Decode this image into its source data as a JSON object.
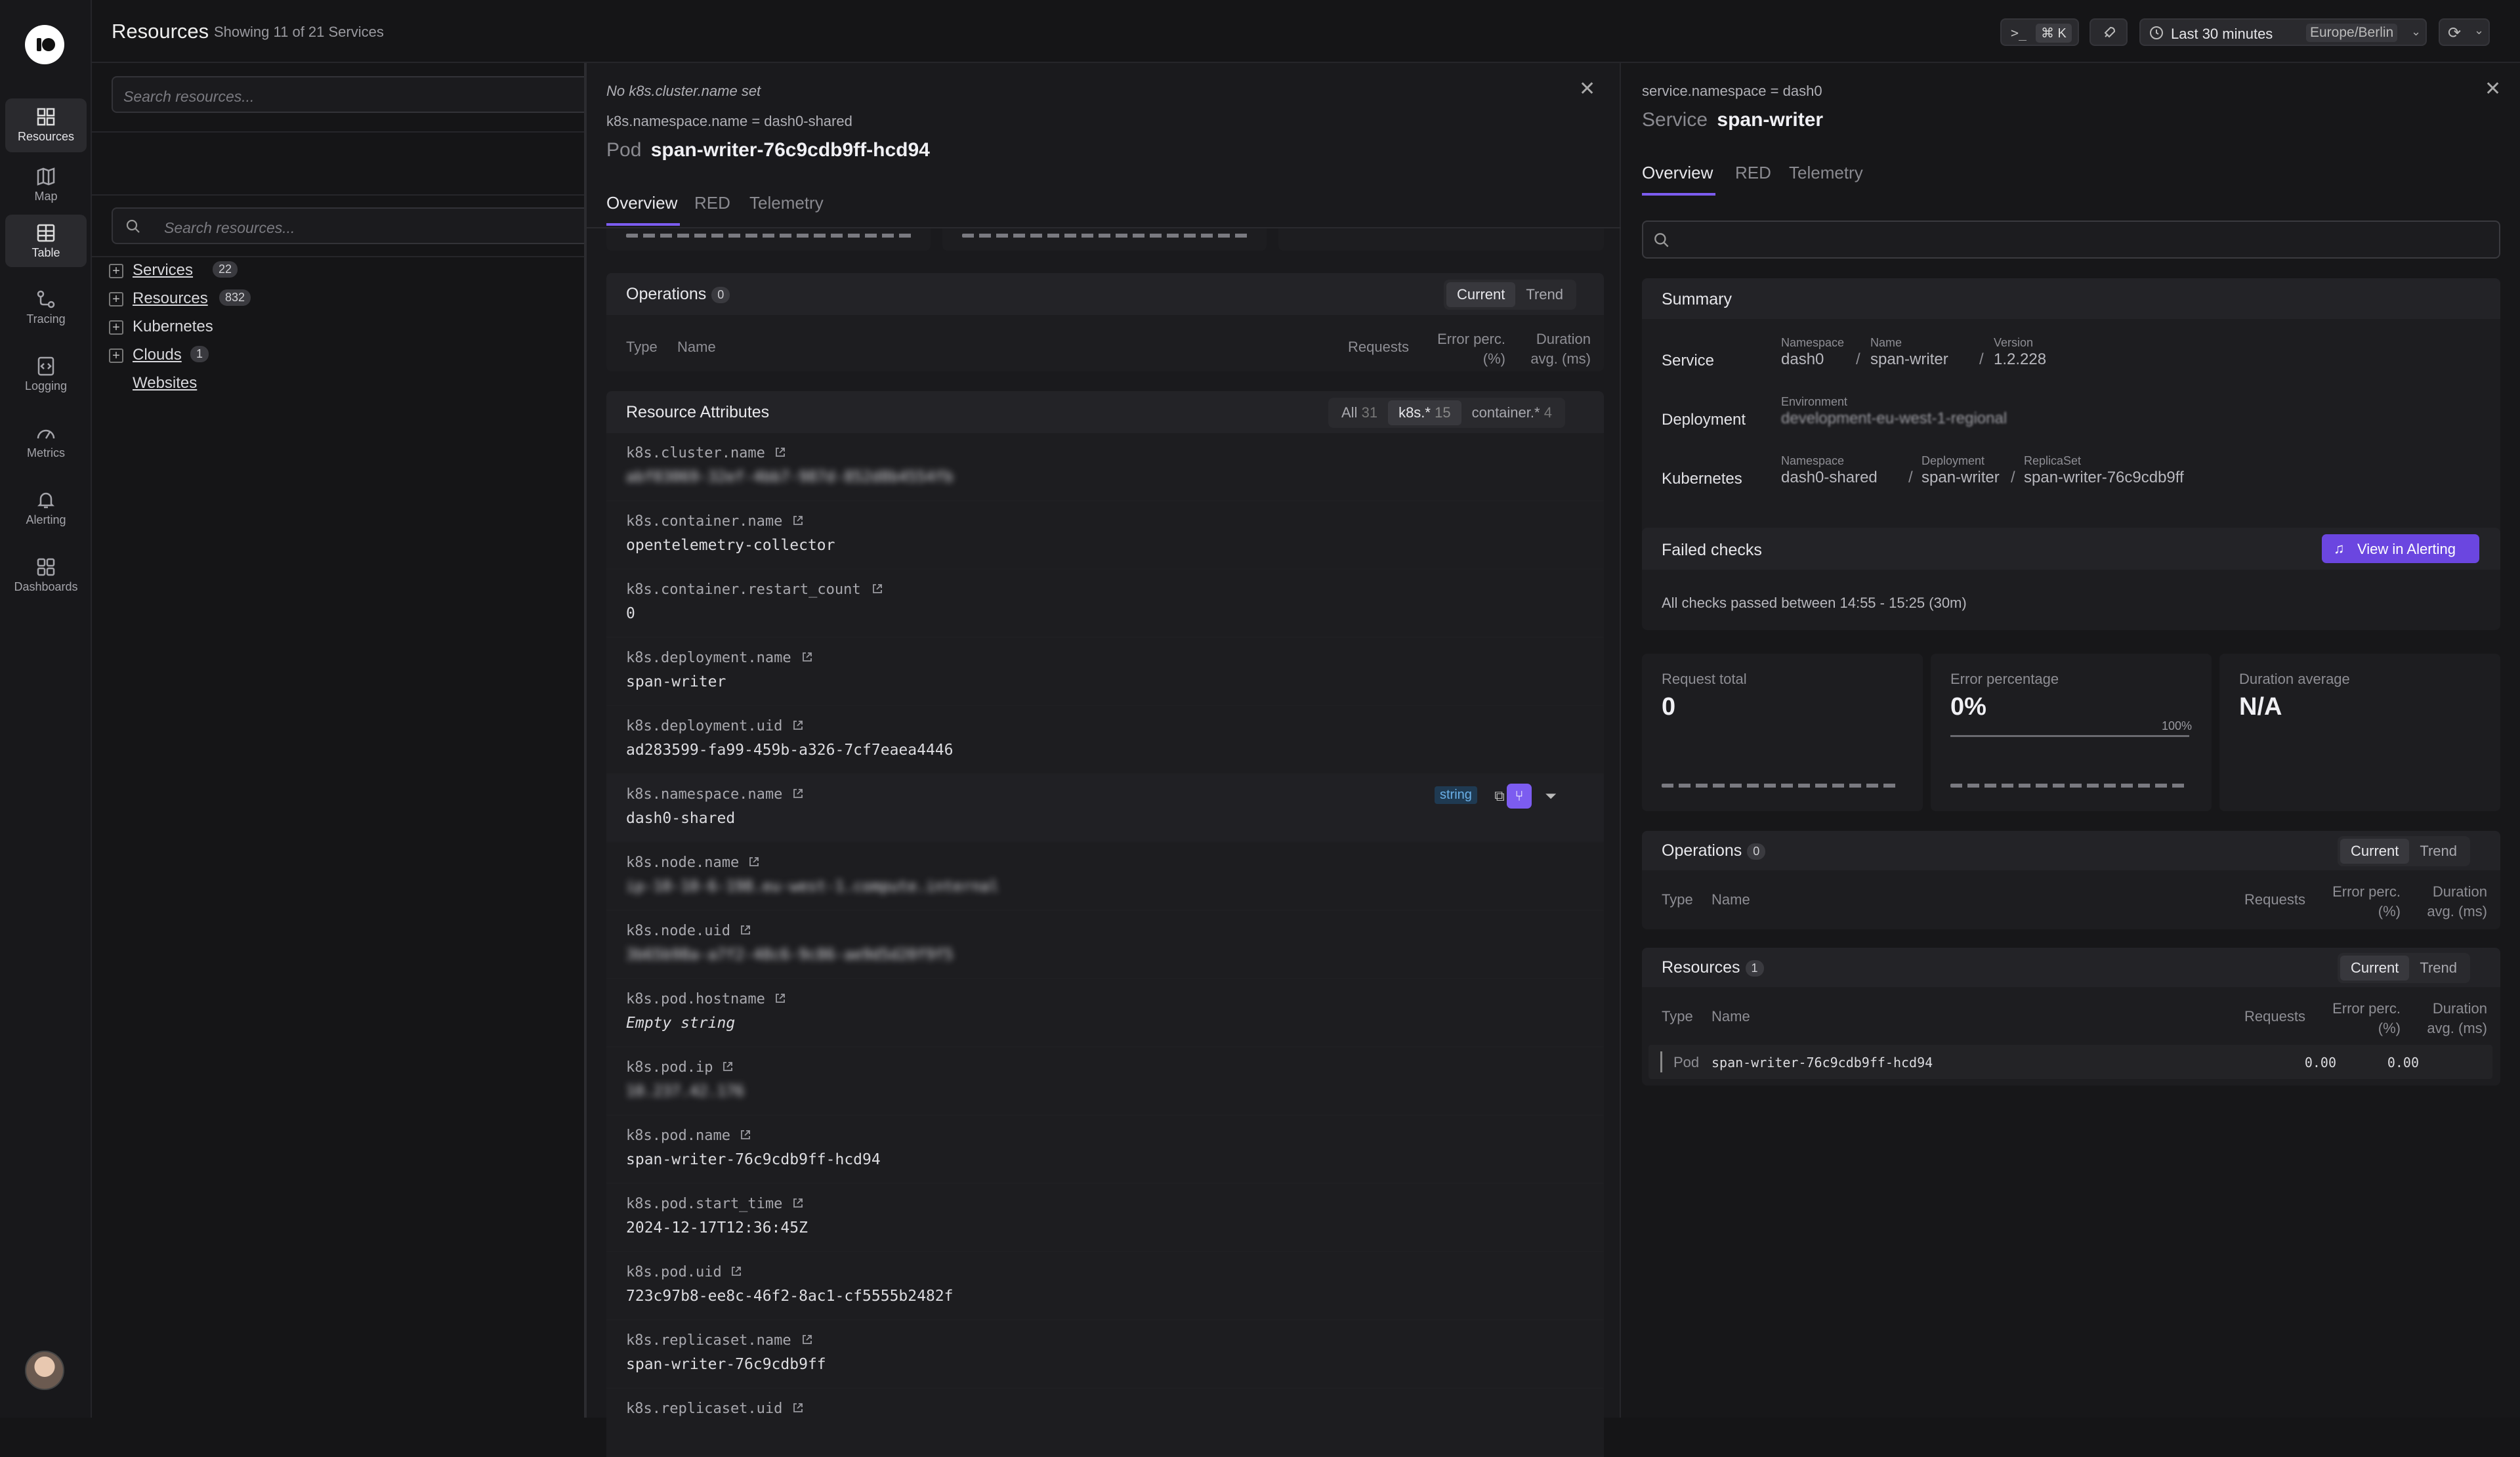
{
  "app": {
    "title": "Resources",
    "subtitle": "Showing 11 of 21 Services"
  },
  "sidebar": {
    "items": [
      {
        "label": "Resources",
        "icon": "resources-icon",
        "active": true
      },
      {
        "label": "Map",
        "icon": "map-icon"
      },
      {
        "label": "Table",
        "icon": "table-icon",
        "active": true
      },
      {
        "label": "Tracing",
        "icon": "tracing-icon"
      },
      {
        "label": "Logging",
        "icon": "logging-icon"
      },
      {
        "label": "Metrics",
        "icon": "metrics-icon"
      },
      {
        "label": "Alerting",
        "icon": "alerting-icon"
      },
      {
        "label": "Dashboards",
        "icon": "dashboards-icon"
      }
    ]
  },
  "topbar": {
    "shortcut": "⌘ K",
    "time_range": "Last 30 minutes",
    "timezone": "Europe/Berlin"
  },
  "list": {
    "search_placeholder": "Search resources...",
    "search2_placeholder": "Search resources...",
    "tree": [
      {
        "label": "Services",
        "count": "22"
      },
      {
        "label": "Resources",
        "count": "832"
      },
      {
        "label": "Kubernetes"
      },
      {
        "label": "Clouds",
        "count": "1"
      },
      {
        "label": "Websites"
      }
    ]
  },
  "pod": {
    "cluster_note": "No k8s.cluster.name set",
    "namespace_filter": "k8s.namespace.name = dash0-shared",
    "kind": "Pod",
    "name": "span-writer-76c9cdb9ff-hcd94",
    "tabs": [
      "Overview",
      "RED",
      "Telemetry"
    ],
    "operations": {
      "title": "Operations",
      "count": "0",
      "toggle": [
        "Current",
        "Trend"
      ],
      "cols": [
        "Type",
        "Name",
        "Requests",
        "Error perc. (%)",
        "Duration avg. (ms)"
      ]
    },
    "attributes": {
      "title": "Resource Attributes",
      "filters": [
        {
          "label": "All",
          "count": "31"
        },
        {
          "label": "k8s.*",
          "count": "15"
        },
        {
          "label": "container.*",
          "count": "4"
        }
      ],
      "type_badge": "string",
      "items": [
        {
          "key": "k8s.cluster.name",
          "value": "abf03069-32ef-4bb7-987d-852d8b4554fb",
          "blur": true
        },
        {
          "key": "k8s.container.name",
          "value": "opentelemetry-collector"
        },
        {
          "key": "k8s.container.restart_count",
          "value": "0"
        },
        {
          "key": "k8s.deployment.name",
          "value": "span-writer"
        },
        {
          "key": "k8s.deployment.uid",
          "value": "ad283599-fa99-459b-a326-7cf7eaea4446"
        },
        {
          "key": "k8s.namespace.name",
          "value": "dash0-shared"
        },
        {
          "key": "k8s.node.name",
          "value": "ip-10-10-6-198.eu-west-1.compute.internal",
          "blur": true
        },
        {
          "key": "k8s.node.uid",
          "value": "3b65b98a-a7f2-48c6-9c86-ae9d5d20f9f5",
          "blur": true
        },
        {
          "key": "k8s.pod.hostname",
          "value": "Empty string",
          "italic": true
        },
        {
          "key": "k8s.pod.ip",
          "value": "10.237.42.176",
          "blur": true
        },
        {
          "key": "k8s.pod.name",
          "value": "span-writer-76c9cdb9ff-hcd94"
        },
        {
          "key": "k8s.pod.start_time",
          "value": "2024-12-17T12:36:45Z"
        },
        {
          "key": "k8s.pod.uid",
          "value": "723c97b8-ee8c-46f2-8ac1-cf5555b2482f"
        },
        {
          "key": "k8s.replicaset.name",
          "value": "span-writer-76c9cdb9ff"
        },
        {
          "key": "k8s.replicaset.uid",
          "value": ""
        }
      ]
    }
  },
  "service": {
    "namespace_filter": "service.namespace = dash0",
    "kind": "Service",
    "name": "span-writer",
    "tabs": [
      "Overview",
      "RED",
      "Telemetry"
    ],
    "summary": {
      "title": "Summary",
      "service": {
        "label": "Service",
        "ns_label": "Namespace",
        "ns": "dash0",
        "name_label": "Name",
        "name": "span-writer",
        "ver_label": "Version",
        "ver": "1.2.228"
      },
      "deployment": {
        "label": "Deployment",
        "env_label": "Environment",
        "env": "development-eu-west-1-regional"
      },
      "kubernetes": {
        "label": "Kubernetes",
        "ns_label": "Namespace",
        "ns": "dash0-shared",
        "dep_label": "Deployment",
        "dep": "span-writer",
        "rs_label": "ReplicaSet",
        "rs": "span-writer-76c9cdb9ff"
      }
    },
    "failed_checks": {
      "title": "Failed checks",
      "button": "View in Alerting",
      "message": "All checks passed between 14:55 - 15:25 (30m)"
    },
    "metrics": [
      {
        "label": "Request total",
        "value": "0"
      },
      {
        "label": "Error percentage",
        "value": "0%",
        "max": "100%",
        "fraction": 0
      },
      {
        "label": "Duration average",
        "value": "N/A"
      }
    ],
    "operations": {
      "title": "Operations",
      "count": "0",
      "toggle": [
        "Current",
        "Trend"
      ],
      "cols": [
        "Type",
        "Name",
        "Requests",
        "Error perc. (%)",
        "Duration avg. (ms)"
      ]
    },
    "resources": {
      "title": "Resources",
      "count": "1",
      "toggle": [
        "Current",
        "Trend"
      ],
      "cols": [
        "Type",
        "Name",
        "Requests",
        "Error perc. (%)",
        "Duration avg. (ms)"
      ],
      "rows": [
        {
          "type": "Pod",
          "name": "span-writer-76c9cdb9ff-hcd94",
          "requests": "0.00",
          "error": "0.00",
          "duration": ""
        }
      ]
    }
  },
  "colors": {
    "accent": "#6b46e0",
    "bg": "#151517"
  }
}
